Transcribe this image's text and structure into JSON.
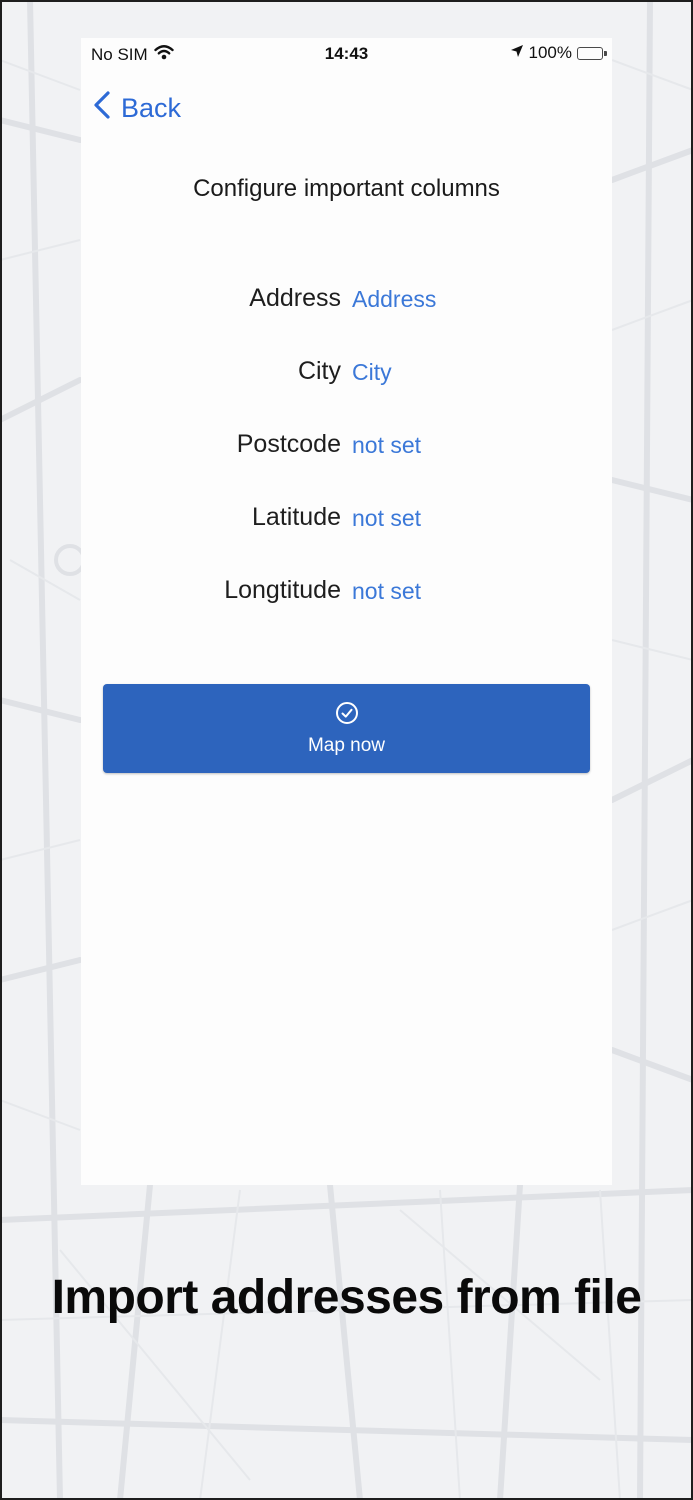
{
  "status_bar": {
    "carrier": "No SIM",
    "time": "14:43",
    "battery": "100%",
    "battery_level": 1.0,
    "icons": [
      "wifi-icon",
      "location-arrow-icon",
      "battery-charging-icon"
    ]
  },
  "nav": {
    "back_label": "Back",
    "back_icon": "chevron-left-icon"
  },
  "screen": {
    "title": "Configure important columns"
  },
  "columns": [
    {
      "label": "Address",
      "value": "Address"
    },
    {
      "label": "City",
      "value": "City"
    },
    {
      "label": "Postcode",
      "value": "not set"
    },
    {
      "label": "Latitude",
      "value": "not set"
    },
    {
      "label": "Longtitude",
      "value": "not set"
    }
  ],
  "action": {
    "label": "Map now",
    "icon": "check-circle-icon"
  },
  "caption": "Import addresses from file",
  "colors": {
    "accent": "#2d6ad6",
    "button": "#2d64bd",
    "value_text": "#3b78d8",
    "battery_fill": "#36c24a",
    "background": "#f1f2f4"
  }
}
